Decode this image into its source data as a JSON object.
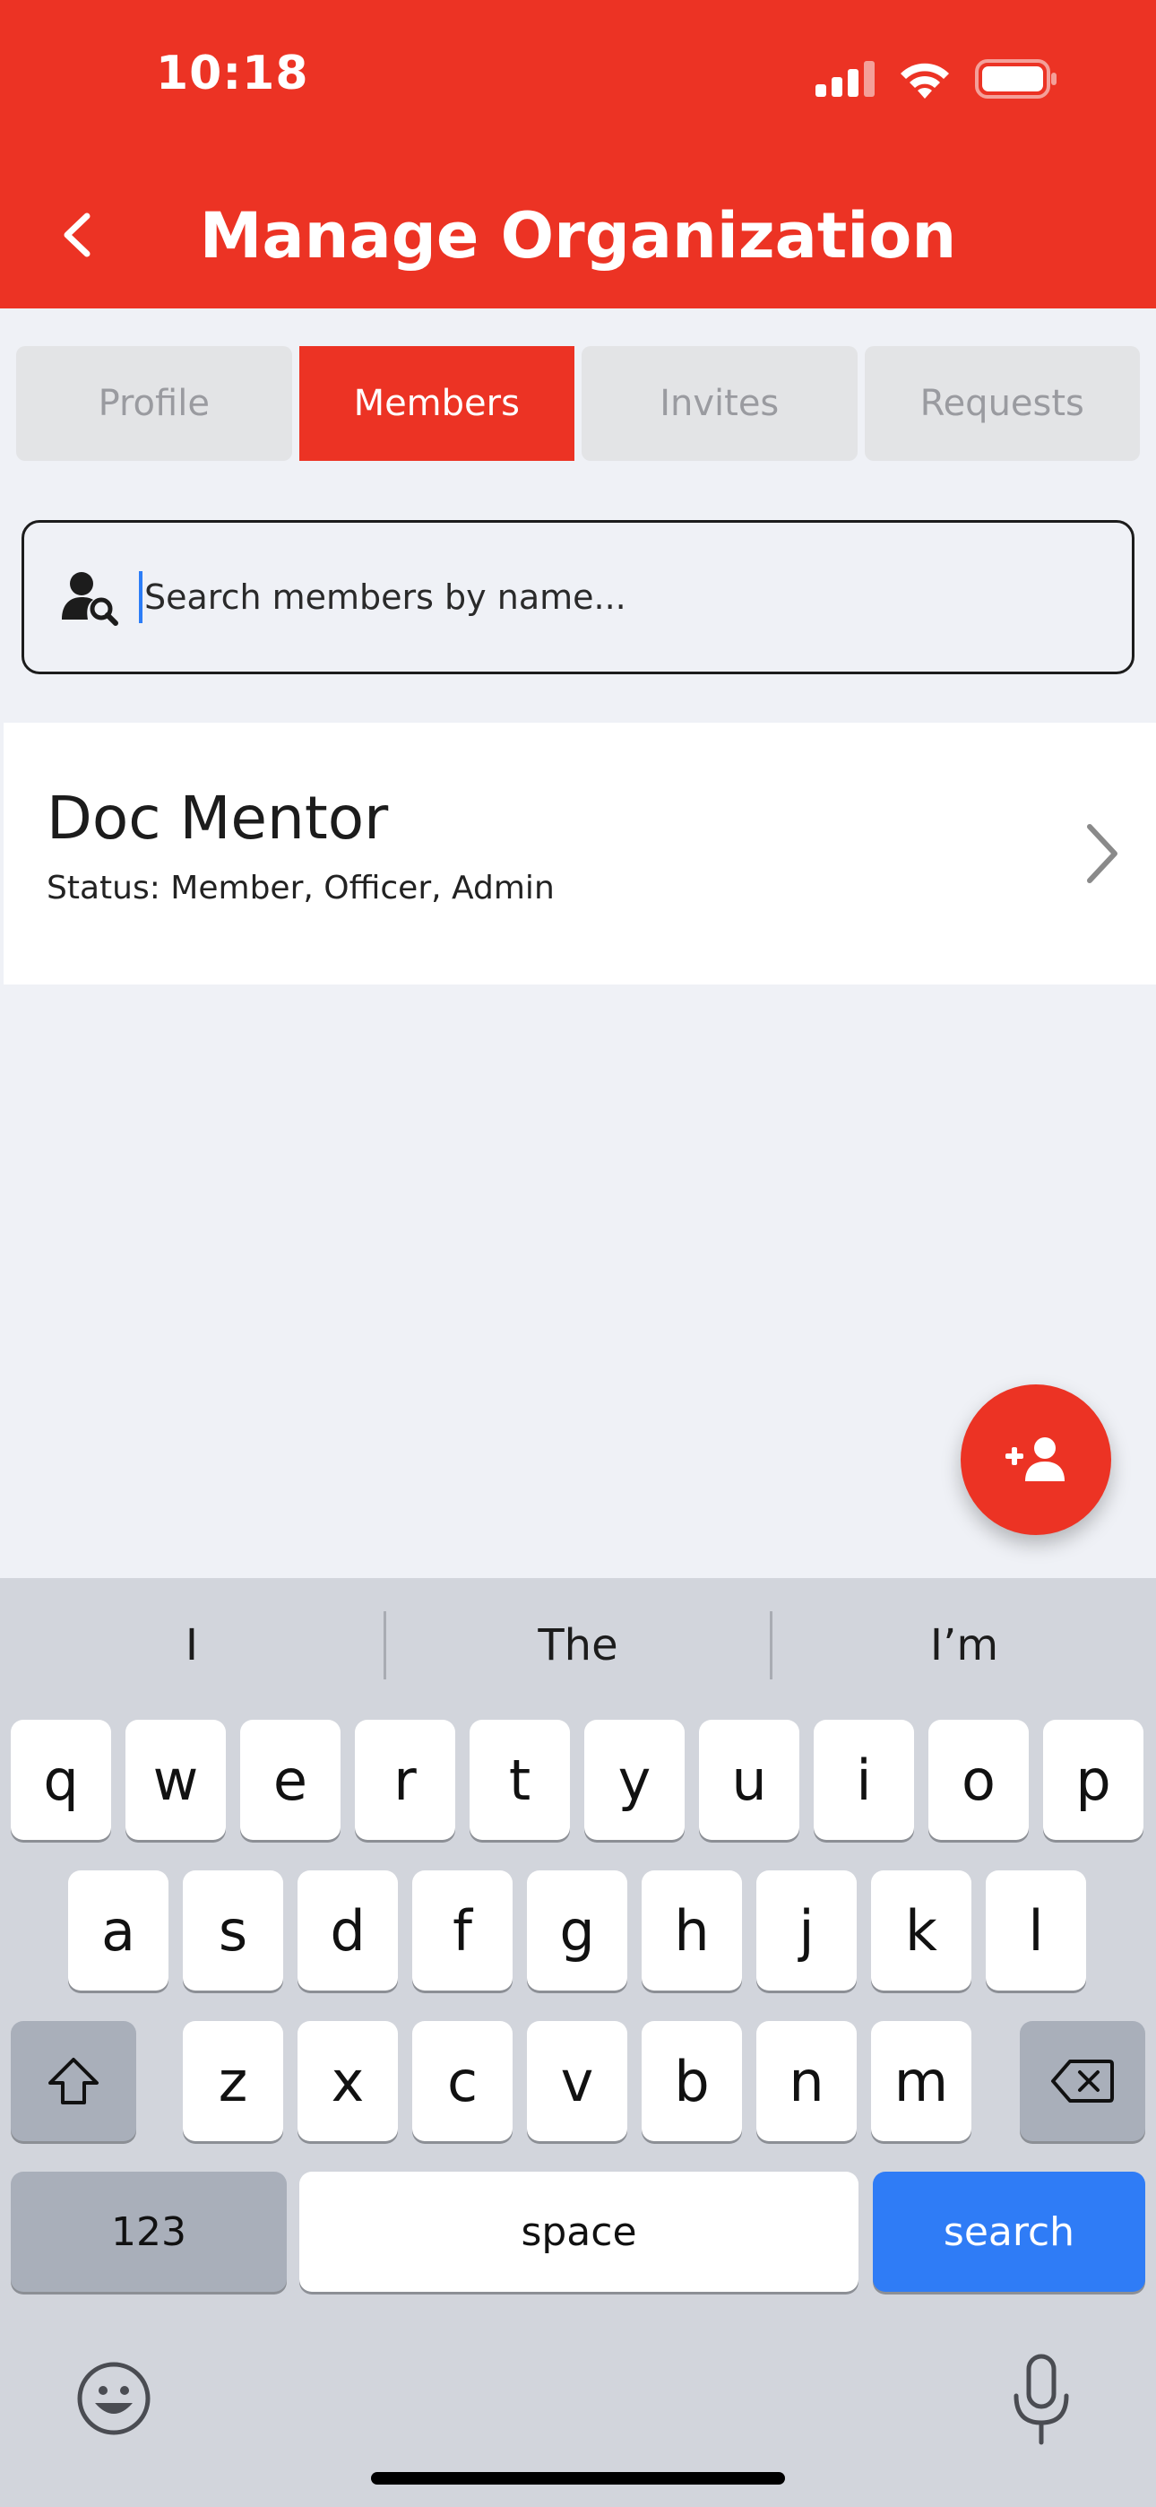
{
  "status_bar": {
    "time": "10:18"
  },
  "header": {
    "title": "Manage Organization"
  },
  "tabs": [
    {
      "label": "Profile",
      "active": false
    },
    {
      "label": "Members",
      "active": true
    },
    {
      "label": "Invites",
      "active": false
    },
    {
      "label": "Requests",
      "active": false
    }
  ],
  "search": {
    "placeholder": "Search members by name..."
  },
  "members": [
    {
      "name": "Doc Mentor",
      "status": "Status: Member, Officer, Admin"
    }
  ],
  "keyboard": {
    "suggestions": [
      "I",
      "The",
      "I’m"
    ],
    "row1": [
      "q",
      "w",
      "e",
      "r",
      "t",
      "y",
      "u",
      "i",
      "o",
      "p"
    ],
    "row2": [
      "a",
      "s",
      "d",
      "f",
      "g",
      "h",
      "j",
      "k",
      "l"
    ],
    "row3": [
      "z",
      "x",
      "c",
      "v",
      "b",
      "n",
      "m"
    ],
    "numbers_key": "123",
    "space_key": "space",
    "action_key": "search"
  },
  "colors": {
    "accent": "#ec3324",
    "keyboard_action": "#2f7cf6"
  },
  "icons": [
    "back-chevron-icon",
    "signal-icon",
    "wifi-icon",
    "battery-icon",
    "user-search-icon",
    "chevron-right-icon",
    "add-person-icon",
    "shift-icon",
    "delete-icon",
    "emoji-icon",
    "microphone-icon"
  ]
}
